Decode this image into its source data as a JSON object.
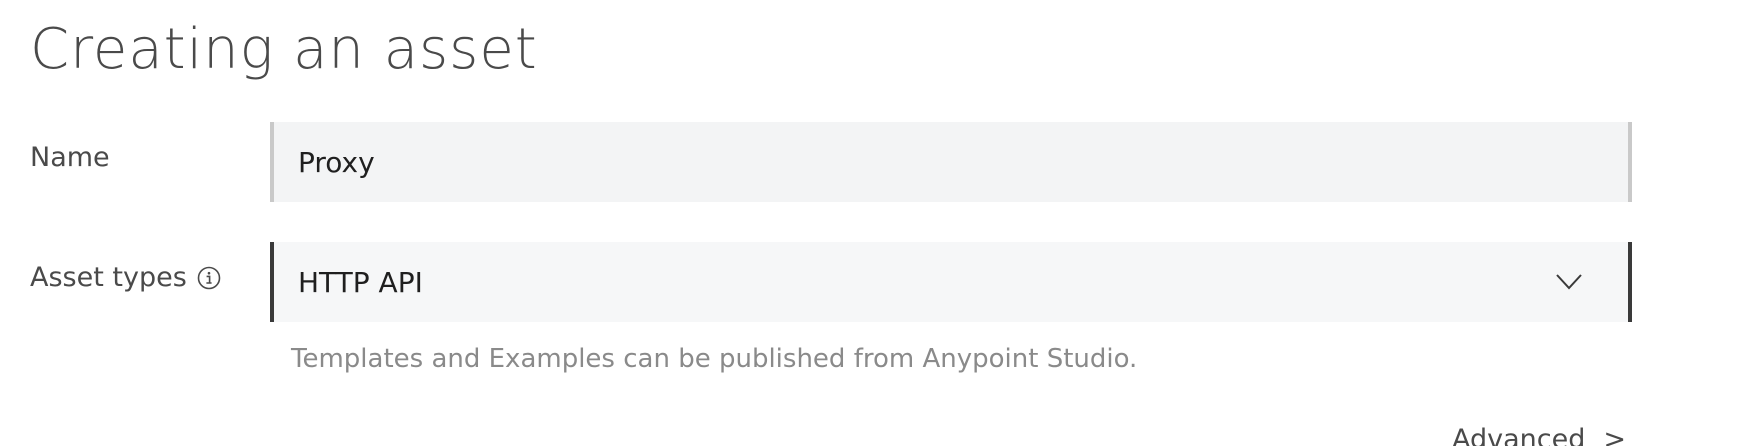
{
  "page": {
    "title": "Creating an asset"
  },
  "form": {
    "name_label": "Name",
    "name_value": "Proxy",
    "asset_types_label": "Asset types",
    "asset_type_selected": "HTTP API",
    "helper_text": "Templates and Examples can be published from Anypoint Studio.",
    "advanced_label": "Advanced",
    "advanced_chevron": ">"
  },
  "icons": {
    "info": "info-icon",
    "dropdown": "chevron-down-icon"
  },
  "colors": {
    "text": "#4a4a4a",
    "field_bg": "#f3f4f5",
    "name_border": "#c9c9c9",
    "select_border": "#3a3a3a",
    "helper_text": "#8a8a8a"
  }
}
